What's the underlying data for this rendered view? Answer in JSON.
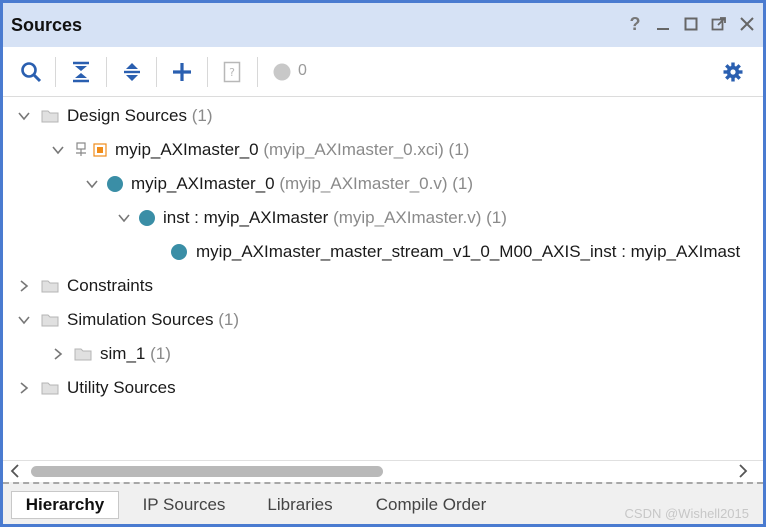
{
  "panel": {
    "title": "Sources",
    "window_buttons": [
      "question-icon",
      "minimize-icon",
      "maximize-icon",
      "float-icon",
      "close-icon"
    ]
  },
  "toolbar": {
    "icons": [
      "search-icon",
      "collapse-all-icon",
      "expand-all-icon",
      "add-icon",
      "properties-icon",
      "status-dot-icon",
      "gear-icon"
    ],
    "count": "0"
  },
  "tree": {
    "design_sources": {
      "label": "Design Sources",
      "count": "(1)"
    },
    "ip": {
      "name": "myip_AXImaster_0",
      "file": "(myip_AXImaster_0.xci)",
      "count": "(1)"
    },
    "top_module": {
      "name": "myip_AXImaster_0",
      "file": "(myip_AXImaster_0.v)",
      "count": "(1)"
    },
    "inst": {
      "name": "inst : myip_AXImaster",
      "file": "(myip_AXImaster.v)",
      "count": "(1)"
    },
    "child": {
      "name": "myip_AXImaster_master_stream_v1_0_M00_AXIS_inst : myip_AXImast"
    },
    "constraints": {
      "label": "Constraints"
    },
    "simulation_sources": {
      "label": "Simulation Sources",
      "count": "(1)"
    },
    "sim_1": {
      "label": "sim_1",
      "count": "(1)"
    },
    "utility_sources": {
      "label": "Utility Sources"
    }
  },
  "tabs": [
    "Hierarchy",
    "IP Sources",
    "Libraries",
    "Compile Order"
  ],
  "active_tab": "Hierarchy",
  "watermark": "CSDN @Wishell2015",
  "colors": {
    "accent_border": "#4a7bd0",
    "titlebar": "#d6e2f5",
    "module_dot": "#3a8ea6",
    "toolbar_icon": "#2a5fb0",
    "ip_square": "#f08c1a"
  }
}
